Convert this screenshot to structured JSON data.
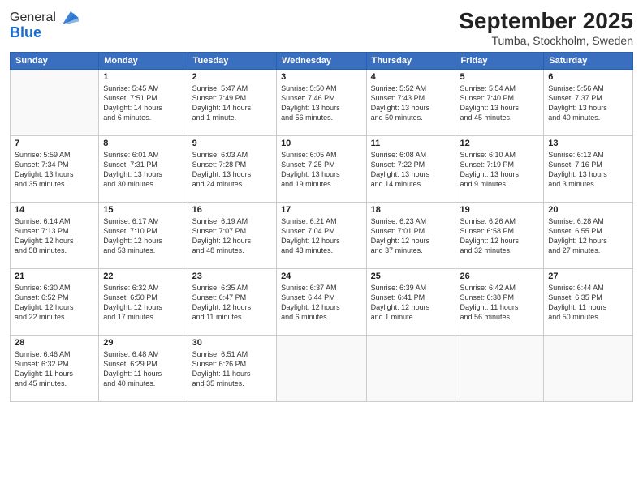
{
  "header": {
    "logo_general": "General",
    "logo_blue": "Blue",
    "month_title": "September 2025",
    "location": "Tumba, Stockholm, Sweden"
  },
  "columns": [
    "Sunday",
    "Monday",
    "Tuesday",
    "Wednesday",
    "Thursday",
    "Friday",
    "Saturday"
  ],
  "weeks": [
    [
      {
        "day": "",
        "info": ""
      },
      {
        "day": "1",
        "info": "Sunrise: 5:45 AM\nSunset: 7:51 PM\nDaylight: 14 hours\nand 6 minutes."
      },
      {
        "day": "2",
        "info": "Sunrise: 5:47 AM\nSunset: 7:49 PM\nDaylight: 14 hours\nand 1 minute."
      },
      {
        "day": "3",
        "info": "Sunrise: 5:50 AM\nSunset: 7:46 PM\nDaylight: 13 hours\nand 56 minutes."
      },
      {
        "day": "4",
        "info": "Sunrise: 5:52 AM\nSunset: 7:43 PM\nDaylight: 13 hours\nand 50 minutes."
      },
      {
        "day": "5",
        "info": "Sunrise: 5:54 AM\nSunset: 7:40 PM\nDaylight: 13 hours\nand 45 minutes."
      },
      {
        "day": "6",
        "info": "Sunrise: 5:56 AM\nSunset: 7:37 PM\nDaylight: 13 hours\nand 40 minutes."
      }
    ],
    [
      {
        "day": "7",
        "info": "Sunrise: 5:59 AM\nSunset: 7:34 PM\nDaylight: 13 hours\nand 35 minutes."
      },
      {
        "day": "8",
        "info": "Sunrise: 6:01 AM\nSunset: 7:31 PM\nDaylight: 13 hours\nand 30 minutes."
      },
      {
        "day": "9",
        "info": "Sunrise: 6:03 AM\nSunset: 7:28 PM\nDaylight: 13 hours\nand 24 minutes."
      },
      {
        "day": "10",
        "info": "Sunrise: 6:05 AM\nSunset: 7:25 PM\nDaylight: 13 hours\nand 19 minutes."
      },
      {
        "day": "11",
        "info": "Sunrise: 6:08 AM\nSunset: 7:22 PM\nDaylight: 13 hours\nand 14 minutes."
      },
      {
        "day": "12",
        "info": "Sunrise: 6:10 AM\nSunset: 7:19 PM\nDaylight: 13 hours\nand 9 minutes."
      },
      {
        "day": "13",
        "info": "Sunrise: 6:12 AM\nSunset: 7:16 PM\nDaylight: 13 hours\nand 3 minutes."
      }
    ],
    [
      {
        "day": "14",
        "info": "Sunrise: 6:14 AM\nSunset: 7:13 PM\nDaylight: 12 hours\nand 58 minutes."
      },
      {
        "day": "15",
        "info": "Sunrise: 6:17 AM\nSunset: 7:10 PM\nDaylight: 12 hours\nand 53 minutes."
      },
      {
        "day": "16",
        "info": "Sunrise: 6:19 AM\nSunset: 7:07 PM\nDaylight: 12 hours\nand 48 minutes."
      },
      {
        "day": "17",
        "info": "Sunrise: 6:21 AM\nSunset: 7:04 PM\nDaylight: 12 hours\nand 43 minutes."
      },
      {
        "day": "18",
        "info": "Sunrise: 6:23 AM\nSunset: 7:01 PM\nDaylight: 12 hours\nand 37 minutes."
      },
      {
        "day": "19",
        "info": "Sunrise: 6:26 AM\nSunset: 6:58 PM\nDaylight: 12 hours\nand 32 minutes."
      },
      {
        "day": "20",
        "info": "Sunrise: 6:28 AM\nSunset: 6:55 PM\nDaylight: 12 hours\nand 27 minutes."
      }
    ],
    [
      {
        "day": "21",
        "info": "Sunrise: 6:30 AM\nSunset: 6:52 PM\nDaylight: 12 hours\nand 22 minutes."
      },
      {
        "day": "22",
        "info": "Sunrise: 6:32 AM\nSunset: 6:50 PM\nDaylight: 12 hours\nand 17 minutes."
      },
      {
        "day": "23",
        "info": "Sunrise: 6:35 AM\nSunset: 6:47 PM\nDaylight: 12 hours\nand 11 minutes."
      },
      {
        "day": "24",
        "info": "Sunrise: 6:37 AM\nSunset: 6:44 PM\nDaylight: 12 hours\nand 6 minutes."
      },
      {
        "day": "25",
        "info": "Sunrise: 6:39 AM\nSunset: 6:41 PM\nDaylight: 12 hours\nand 1 minute."
      },
      {
        "day": "26",
        "info": "Sunrise: 6:42 AM\nSunset: 6:38 PM\nDaylight: 11 hours\nand 56 minutes."
      },
      {
        "day": "27",
        "info": "Sunrise: 6:44 AM\nSunset: 6:35 PM\nDaylight: 11 hours\nand 50 minutes."
      }
    ],
    [
      {
        "day": "28",
        "info": "Sunrise: 6:46 AM\nSunset: 6:32 PM\nDaylight: 11 hours\nand 45 minutes."
      },
      {
        "day": "29",
        "info": "Sunrise: 6:48 AM\nSunset: 6:29 PM\nDaylight: 11 hours\nand 40 minutes."
      },
      {
        "day": "30",
        "info": "Sunrise: 6:51 AM\nSunset: 6:26 PM\nDaylight: 11 hours\nand 35 minutes."
      },
      {
        "day": "",
        "info": ""
      },
      {
        "day": "",
        "info": ""
      },
      {
        "day": "",
        "info": ""
      },
      {
        "day": "",
        "info": ""
      }
    ]
  ]
}
